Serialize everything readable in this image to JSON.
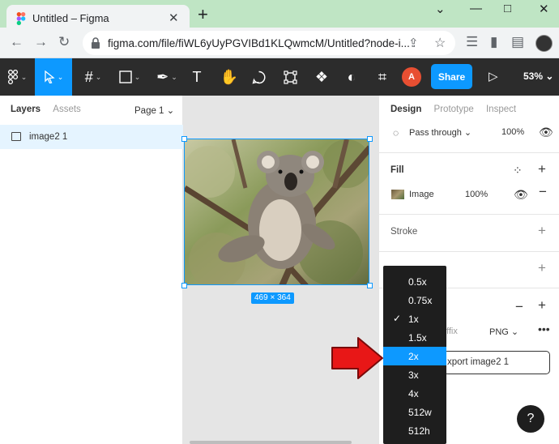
{
  "browser": {
    "tab_title": "Untitled – Figma",
    "tab_close": "✕",
    "new_tab": "+",
    "window_controls": [
      "⌄",
      "—",
      "□",
      "✕"
    ],
    "url": "figma.com/file/fiWL6yUyPGVIBd1KLQwmcM/Untitled?node-i...",
    "nav_icons": [
      "back-icon",
      "forward-icon",
      "reload-icon"
    ]
  },
  "toolbar": {
    "share_label": "Share",
    "zoom_label": "53%",
    "user_initial": "A",
    "tools": [
      "figma-menu-icon",
      "move-tool-icon",
      "frame-tool-icon",
      "rectangle-tool-icon",
      "pen-tool-icon",
      "text-tool-icon",
      "hand-tool-icon",
      "comment-tool-icon",
      "component-icon",
      "assets-icon",
      "contrast-icon",
      "crop-icon"
    ]
  },
  "layers_panel": {
    "tab_layers": "Layers",
    "tab_assets": "Assets",
    "page_label": "Page 1",
    "layer_name": "image2 1"
  },
  "canvas": {
    "size_label": "469 × 364"
  },
  "props_panel": {
    "tabs": [
      "Design",
      "Prototype",
      "Inspect"
    ],
    "blend_mode": "Pass through",
    "layer_opacity": "100%",
    "fill_title": "Fill",
    "fill_type": "Image",
    "fill_opacity": "100%",
    "stroke_title": "Stroke",
    "suffix_placeholder": "ffix",
    "format": "PNG",
    "export_label": "xport image2 1",
    "help": "?"
  },
  "scale_menu": {
    "items": [
      "0.5x",
      "0.75x",
      "1x",
      "1.5x",
      "2x",
      "3x",
      "4x",
      "512w",
      "512h"
    ],
    "checked": "1x",
    "highlighted": "2x"
  },
  "colors": {
    "accent": "#0d99ff",
    "toolbar_bg": "#2c2c2c",
    "tabstrip_bg": "#bfe5c4",
    "arrow": "#e81717"
  }
}
